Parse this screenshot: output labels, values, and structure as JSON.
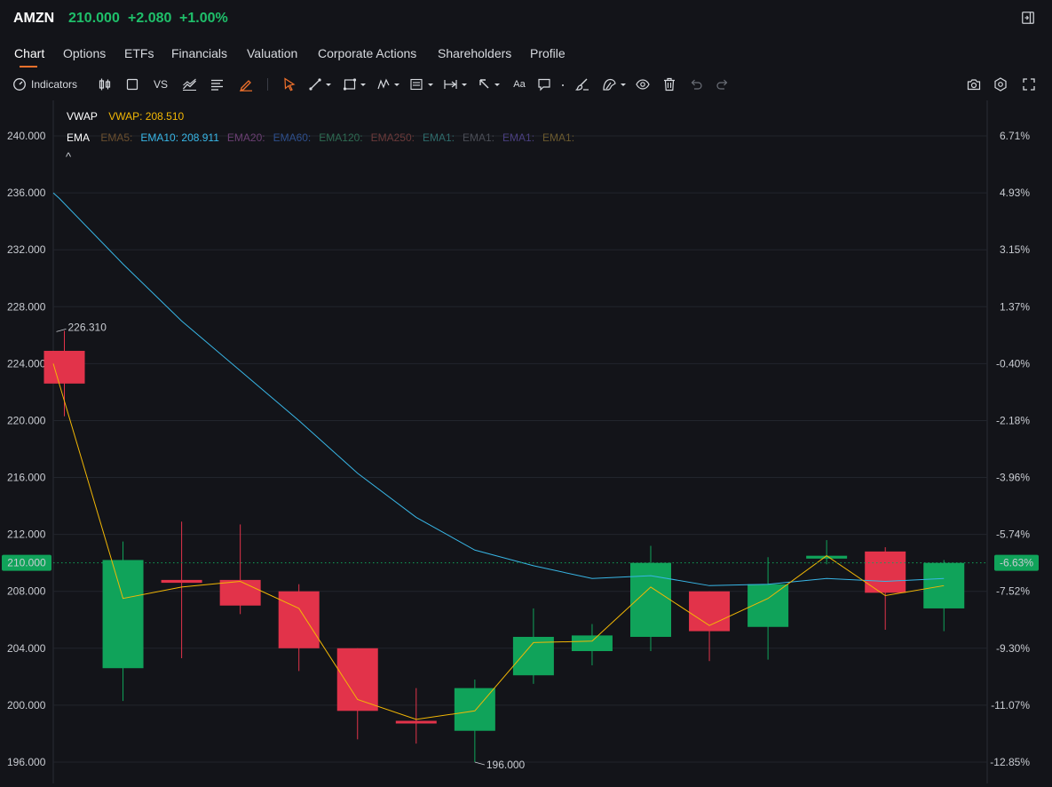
{
  "header": {
    "ticker": "AMZN",
    "price": "210.000",
    "change": "+2.080",
    "change_pct": "+1.00%",
    "price_color": "#1fbf6a",
    "expand_icon": "expand-panel-icon"
  },
  "tabs": [
    {
      "label": "Chart",
      "active": true
    },
    {
      "label": "Options"
    },
    {
      "label": "ETFs"
    },
    {
      "label": "Financials"
    },
    {
      "label": "Valuation"
    },
    {
      "label": "Corporate Actions"
    },
    {
      "label": "Shareholders"
    },
    {
      "label": "Profile"
    }
  ],
  "toolbar": {
    "indicators_label": "Indicators",
    "vs_label": "VS",
    "text_tool_label": "Aa",
    "icons": [
      "gauge-icon",
      "candlestick-icon",
      "square-icon",
      "compare-icon",
      "line-chart-icon",
      "text-align-icon",
      "pencil-icon",
      "cursor-icon",
      "trend-line-icon",
      "rectangle-icon",
      "pattern-icon",
      "fib-icon",
      "measure-icon",
      "arrow-icon",
      "text-icon",
      "comment-icon",
      "brush-icon",
      "magnet-icon",
      "eye-icon",
      "trash-icon",
      "undo-icon",
      "redo-icon",
      "camera-icon",
      "settings-icon",
      "fullscreen-icon"
    ]
  },
  "legend": {
    "vwap_label": "VWAP",
    "vwap_value": "VWAP: 208.510",
    "ema_label": "EMA",
    "ema_items": [
      {
        "text": "EMA5:",
        "color": "#6b4f2e"
      },
      {
        "text": "EMA10: 208.911",
        "color": "#38b6e6"
      },
      {
        "text": "EMA20:",
        "color": "#6b3f73"
      },
      {
        "text": "EMA60:",
        "color": "#2e4f8c"
      },
      {
        "text": "EMA120:",
        "color": "#2e6b52"
      },
      {
        "text": "EMA250:",
        "color": "#6b3a3a"
      },
      {
        "text": "EMA1:",
        "color": "#2e6b6b"
      },
      {
        "text": "EMA1:",
        "color": "#4a4d55"
      },
      {
        "text": "EMA1:",
        "color": "#4a3f80"
      },
      {
        "text": "EMA1:",
        "color": "#6b5a2e"
      }
    ],
    "collapse_icon": "^"
  },
  "chart_data": {
    "type": "candlestick",
    "ylim": [
      194.5,
      242.5
    ],
    "y_ticks": [
      240,
      236,
      232,
      228,
      224,
      220,
      216,
      212,
      208,
      204,
      200,
      196
    ],
    "y_tick_labels": [
      "240.000",
      "236.000",
      "232.000",
      "228.000",
      "224.000",
      "220.000",
      "216.000",
      "212.000",
      "208.000",
      "204.000",
      "200.000",
      "196.000"
    ],
    "right_tick_labels": [
      "6.71%",
      "4.93%",
      "3.15%",
      "1.37%",
      "-0.40%",
      "-2.18%",
      "-3.96%",
      "-5.74%",
      "-7.52%",
      "-9.30%",
      "-11.07%",
      "-12.85%"
    ],
    "up_color": "#10a35a",
    "down_color": "#e2334a",
    "candles": [
      {
        "open": 224.9,
        "high": 226.31,
        "low": 220.3,
        "close": 222.6
      },
      {
        "open": 202.6,
        "high": 211.5,
        "low": 200.3,
        "close": 210.2
      },
      {
        "open": 208.8,
        "high": 212.9,
        "low": 203.3,
        "close": 208.6
      },
      {
        "open": 208.8,
        "high": 212.7,
        "low": 206.4,
        "close": 207.0
      },
      {
        "open": 208.0,
        "high": 208.5,
        "low": 202.4,
        "close": 204.0
      },
      {
        "open": 204.0,
        "high": 204.0,
        "low": 197.6,
        "close": 199.6
      },
      {
        "open": 198.9,
        "high": 201.2,
        "low": 197.3,
        "close": 198.8
      },
      {
        "open": 198.2,
        "high": 201.8,
        "low": 196.0,
        "close": 201.2
      },
      {
        "open": 202.1,
        "high": 206.8,
        "low": 201.5,
        "close": 204.8
      },
      {
        "open": 203.8,
        "high": 205.7,
        "low": 202.8,
        "close": 204.9
      },
      {
        "open": 204.8,
        "high": 211.2,
        "low": 203.8,
        "close": 210.0
      },
      {
        "open": 208.0,
        "high": 208.0,
        "low": 203.1,
        "close": 205.2
      },
      {
        "open": 205.5,
        "high": 210.4,
        "low": 203.2,
        "close": 208.5
      },
      {
        "open": 210.3,
        "high": 211.6,
        "low": 209.9,
        "close": 210.5
      },
      {
        "open": 210.8,
        "high": 211.1,
        "low": 205.3,
        "close": 207.9
      },
      {
        "open": 206.8,
        "high": 210.2,
        "low": 205.2,
        "close": 210.0
      }
    ],
    "ema10": [
      236.0,
      235.6,
      231.0,
      227.0,
      223.5,
      220.0,
      216.3,
      213.2,
      210.9,
      209.8,
      208.9,
      209.1,
      208.4,
      208.5,
      208.9,
      208.7,
      208.9
    ],
    "vwap": [
      224.0,
      207.5,
      208.3,
      208.7,
      206.8,
      200.4,
      199.0,
      199.6,
      204.4,
      204.5,
      208.3,
      205.6,
      207.5,
      210.5,
      207.7,
      208.4
    ],
    "ema10_color": "#38b6e6",
    "vwap_color": "#f2b705",
    "last_price": 210.0,
    "last_price_label": "210.000",
    "last_price_pct": "-6.63%",
    "high_label": "226.310",
    "low_label": "196.000",
    "grid": true
  }
}
